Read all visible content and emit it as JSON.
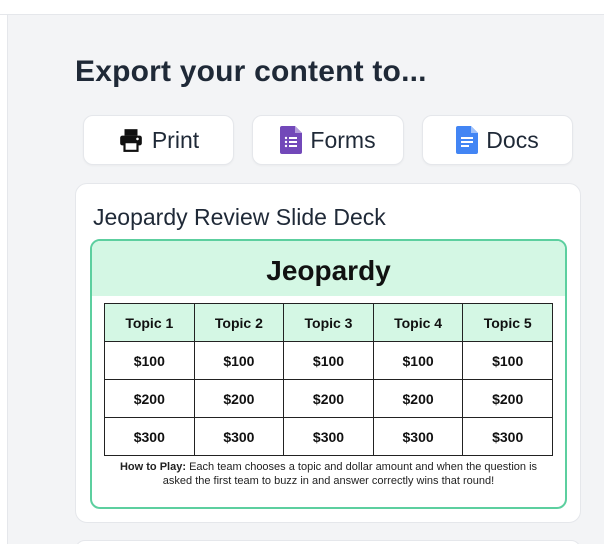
{
  "heading": "Export your content to...",
  "export_buttons": [
    {
      "label": "Print",
      "icon": "printer-icon"
    },
    {
      "label": "Forms",
      "icon": "google-forms-icon"
    },
    {
      "label": "Docs",
      "icon": "google-docs-icon"
    }
  ],
  "card": {
    "title": "Jeopardy Review Slide Deck",
    "slide": {
      "title": "Jeopardy",
      "topics": [
        "Topic 1",
        "Topic 2",
        "Topic 3",
        "Topic 4",
        "Topic 5"
      ],
      "rows": [
        [
          "$100",
          "$100",
          "$100",
          "$100",
          "$100"
        ],
        [
          "$200",
          "$200",
          "$200",
          "$200",
          "$200"
        ],
        [
          "$300",
          "$300",
          "$300",
          "$300",
          "$300"
        ]
      ],
      "howto_label": "How to Play:",
      "howto_text": "Each team chooses a topic and dollar amount and when the question is asked the first team to buzz in and answer correctly wins that round!"
    }
  },
  "colors": {
    "accent_green": "#5ccf9f",
    "band_green": "#d4f7e4",
    "forms_purple": "#7248b9",
    "docs_blue": "#4285f4"
  }
}
